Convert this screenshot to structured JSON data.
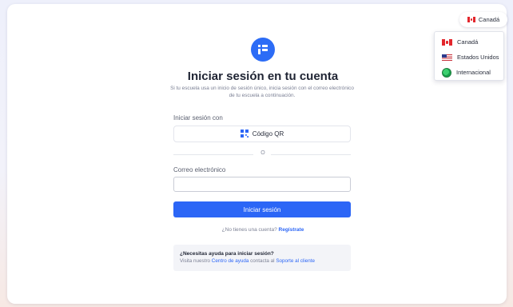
{
  "brand": {
    "accent": "#2c66f6"
  },
  "login": {
    "title": "Iniciar sesión en tu cuenta",
    "subtitle": "Si tu escuela usa un inicio de sesión único, inicia sesión con el correo electrónico de tu escuela a continuación.",
    "sign_in_with_label": "Iniciar sesión con",
    "qr_button_label": "Código QR",
    "divider_text": "O",
    "email_label": "Correo electrónico",
    "email_value": "",
    "email_placeholder": "",
    "submit_label": "Iniciar sesión",
    "no_account_text": "¿No tienes una cuenta?",
    "register_link": "Regístrate"
  },
  "help": {
    "title": "¿Necesitas ayuda para iniciar sesión?",
    "text_visit": "Visita nuestro",
    "help_center_link": "Centro de ayuda",
    "text_contact": "contacta al",
    "support_link": "Soporte al cliente"
  },
  "country_selector": {
    "selected": "Canadá",
    "selected_icon": "canada-flag-icon",
    "options": [
      {
        "label": "Canadá",
        "icon": "canada-flag-icon"
      },
      {
        "label": "Estados Unidos",
        "icon": "us-flag-icon"
      },
      {
        "label": "Internacional",
        "icon": "globe-icon"
      }
    ]
  }
}
